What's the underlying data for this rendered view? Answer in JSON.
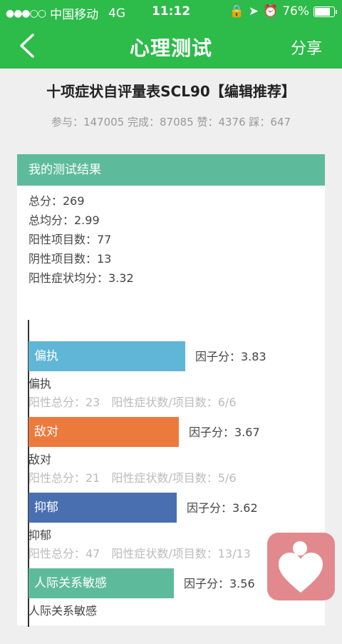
{
  "status": {
    "carrier": "中国移动",
    "network": "4G",
    "time": "11:12",
    "battery": "76%"
  },
  "nav": {
    "title": "心理测试",
    "share_label": "分享"
  },
  "test": {
    "title": "十项症状自评量表SCL90【编辑推荐】",
    "stats": "参与：147005 完成：87085 赞：4376 踩：647"
  },
  "result": {
    "header": "我的测试结果",
    "summary": [
      "总分：269",
      "总均分：2.99",
      "阳性项目数：77",
      "阴性项目数：13",
      "阳性症状均分：3.32"
    ]
  },
  "chart_data": {
    "type": "bar",
    "orientation": "horizontal",
    "categories": [
      "偏执",
      "敌对",
      "抑郁",
      "人际关系敏感"
    ],
    "values": [
      3.83,
      3.67,
      3.62,
      3.56
    ],
    "colors": [
      "#5fb6d6",
      "#ec7a3c",
      "#4a6fb0",
      "#5dbb9b"
    ],
    "score_prefix": "因子分：",
    "details": [
      "阳性总分：23　阳性症状数/项目数：6/6",
      "阳性总分：21　阳性症状数/项目数：5/6",
      "阳性总分：47　阳性症状数/项目数：13/13",
      ""
    ]
  }
}
